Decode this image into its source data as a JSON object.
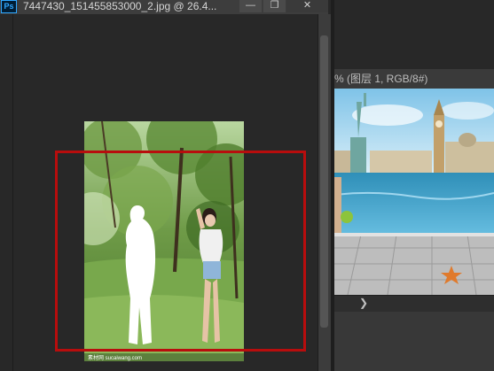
{
  "app": {
    "badge": "Ps"
  },
  "left_document": {
    "title": "7447430_151455853000_2.jpg @ 26.4..."
  },
  "window_controls": {
    "minimize": "—",
    "restore": "❐",
    "close": "✕"
  },
  "right_document": {
    "title_partial": "% (图层 1, RGB/8#)",
    "nav_arrow": "❯"
  },
  "photo_watermark": "素材网 sucaiwang.com"
}
